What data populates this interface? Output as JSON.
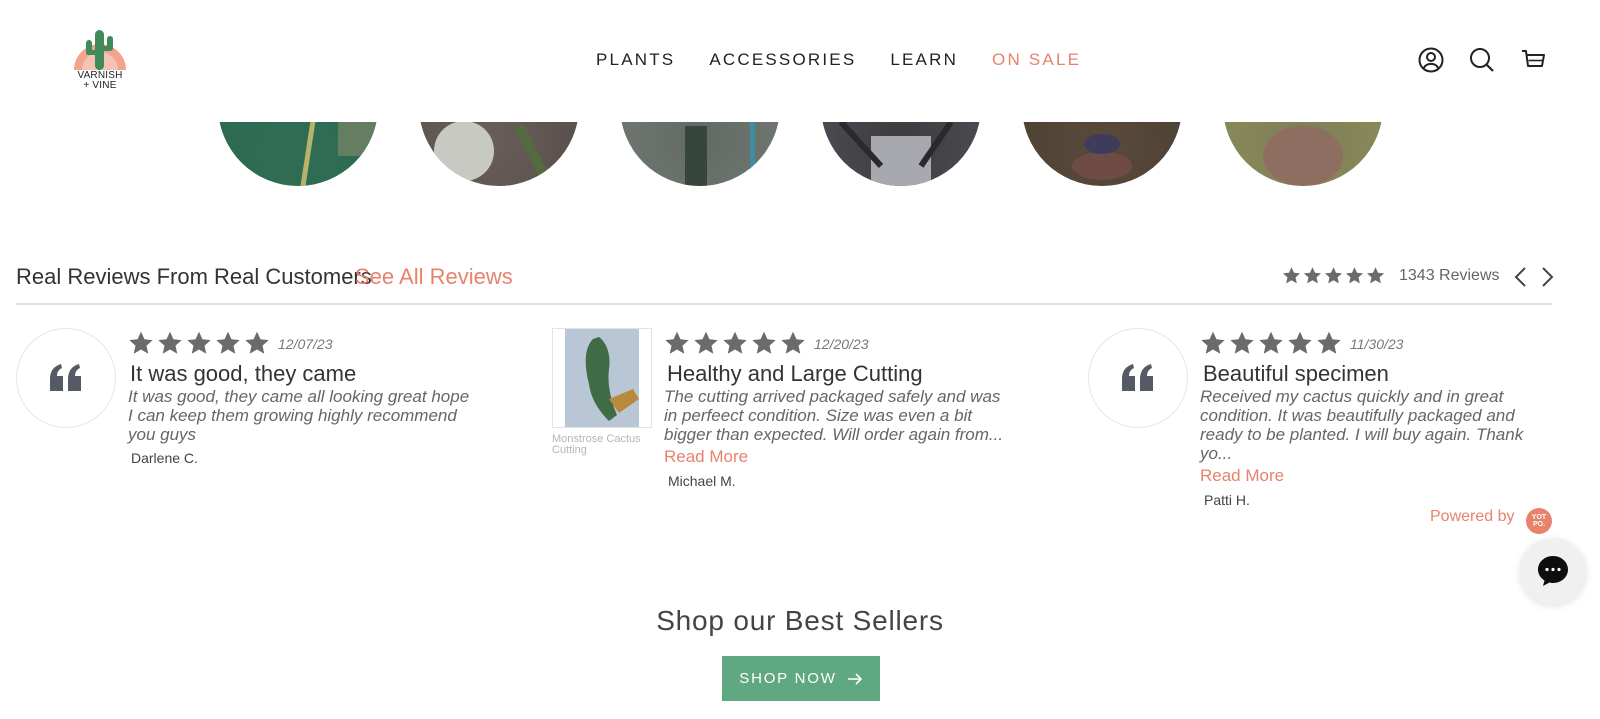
{
  "brand": {
    "logo_line1": "VARNISH",
    "logo_line2": "+ VINE"
  },
  "nav": {
    "items": [
      {
        "label": "PLANTS"
      },
      {
        "label": "ACCESSORIES"
      },
      {
        "label": "LEARN"
      },
      {
        "label": "ON SALE"
      }
    ]
  },
  "header_icons": [
    "account-icon",
    "search-icon",
    "cart-icon"
  ],
  "reviews": {
    "title": "Real Reviews From Real Customers",
    "see_all": "See All Reviews",
    "count": "1343 Reviews",
    "rating_stars": 5,
    "items": [
      {
        "date": "12/07/23",
        "title": "It was good, they came",
        "body": "It was good, they came all looking great hope I can keep them growing highly recommend you guys",
        "author": "Darlene C.",
        "stars": 5
      },
      {
        "date": "12/20/23",
        "title": "Healthy and Large Cutting",
        "body": "The cutting arrived packaged safely and was in perfeect condition. Size was even a bit bigger than expected. Will order again from...",
        "read_more": "Read More",
        "author": "Michael M.",
        "photo_caption": "Monstrose Cactus Cutting",
        "stars": 5
      },
      {
        "date": "11/30/23",
        "title": "Beautiful specimen",
        "body": "Received my cactus quickly and in great condition. It was beautifully packaged and ready to be planted. I will buy again. Thank yo...",
        "read_more": "Read More",
        "author": "Patti H.",
        "stars": 5
      }
    ],
    "powered_by": "Powered by",
    "powered_logo": "YOT PO."
  },
  "best_sellers": {
    "title": "Shop our Best Sellers",
    "button": "SHOP NOW"
  },
  "colors": {
    "accent": "#e8826c",
    "button": "#5fa882",
    "star": "#6b6b6b"
  }
}
